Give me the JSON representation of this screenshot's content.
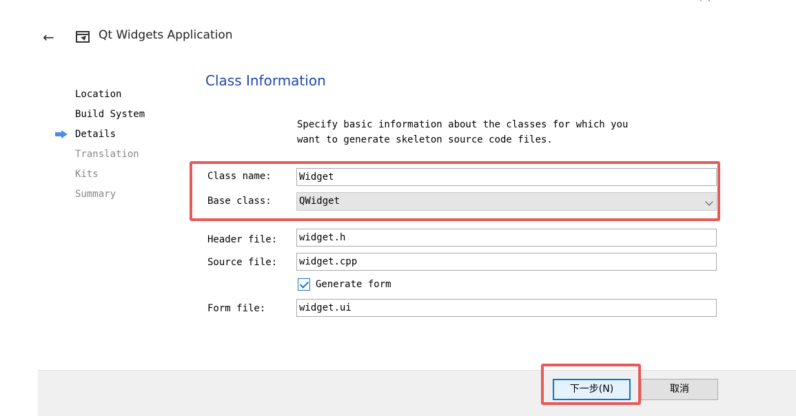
{
  "header": {
    "title": "Qt Widgets Application"
  },
  "steps": [
    {
      "label": "Location",
      "state": "done"
    },
    {
      "label": "Build System",
      "state": "done"
    },
    {
      "label": "Details",
      "state": "current"
    },
    {
      "label": "Translation",
      "state": "pending"
    },
    {
      "label": "Kits",
      "state": "pending"
    },
    {
      "label": "Summary",
      "state": "pending"
    }
  ],
  "main": {
    "section_title": "Class Information",
    "description_line1": "Specify basic information about the classes for which you",
    "description_line2": "want to generate skeleton source code files."
  },
  "form": {
    "class_name_label": "Class name:",
    "class_name_value": "Widget",
    "base_class_label": "Base class:",
    "base_class_value": "QWidget",
    "header_file_label": "Header file:",
    "header_file_value": "widget.h",
    "source_file_label": "Source file:",
    "source_file_value": "widget.cpp",
    "generate_form_label": "Generate form",
    "generate_form_checked": true,
    "form_file_label": "Form file:",
    "form_file_value": "widget.ui"
  },
  "footer": {
    "next_label": "下一步(N)",
    "cancel_label": "取消"
  },
  "colors": {
    "title_blue": "#1f47b0",
    "current_step_arrow": "#4a90e2",
    "highlight_red": "#e85a5a",
    "focus_blue": "#0078d7"
  },
  "icons": {
    "back": "back-arrow-icon",
    "wizard": "application-window-icon",
    "current_step": "current-step-arrow-icon",
    "dropdown": "chevron-down-icon",
    "checkbox": "checkmark-icon"
  }
}
